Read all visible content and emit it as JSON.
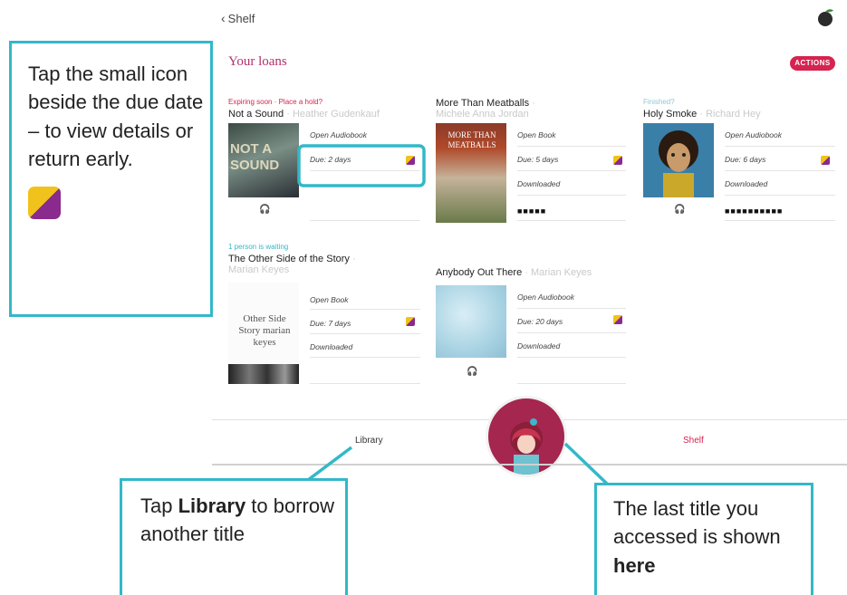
{
  "header": {
    "back_label": "Shelf",
    "section_title": "Your loans",
    "actions_label": "ACTIONS"
  },
  "loans": [
    {
      "tag": "Expiring soon · Place a hold?",
      "tag_color": "#d6234f",
      "title": "Not a Sound",
      "author": "Heather Gudenkauf",
      "cover_text": "NOT A SOUND",
      "action": "Open Audiobook",
      "due": "Due: 2 days",
      "status": "",
      "progress": ""
    },
    {
      "tag": "",
      "tag_color": "#d6234f",
      "title": "More Than Meatballs",
      "author": "Michele Anna Jordan",
      "cover_text": "MORE THAN MEATBALLS",
      "action": "Open Book",
      "due": "Due: 5 days",
      "status": "Downloaded",
      "progress": "■■■■■"
    },
    {
      "tag": "Finished?",
      "tag_color": "#8fc9d5",
      "title": "Holy Smoke",
      "author": "Richard Hey",
      "cover_text": "",
      "action": "Open Audiobook",
      "due": "Due: 6 days",
      "status": "Downloaded",
      "progress": "■■■■■■■■■■"
    },
    {
      "tag": "1 person is waiting",
      "tag_color": "#33b8c9",
      "title": "The Other Side of the Story",
      "author": "Marian Keyes",
      "cover_text": "Other Side Story marian keyes",
      "action": "Open Book",
      "due": "Due: 7 days",
      "status": "Downloaded",
      "progress": ""
    },
    {
      "tag": "",
      "tag_color": "#d6234f",
      "title": "Anybody Out There",
      "author": "Marian Keyes",
      "cover_text": "",
      "action": "Open Audiobook",
      "due": "Due: 20 days",
      "status": "Downloaded",
      "progress": ""
    }
  ],
  "tabbar": {
    "library_label": "Library",
    "shelf_label": "Shelf"
  },
  "callouts": {
    "due_icon": {
      "text": "Tap the small icon beside the due date – to view details or return early."
    },
    "library": {
      "pre": "Tap ",
      "bold": "Library",
      "post": " to borrow another title"
    },
    "last_title": {
      "pre": "The last title you accessed is shown ",
      "bold": "here"
    }
  },
  "colors": {
    "accent": "#d6234f",
    "callout_border": "#33b8c9",
    "section_title": "#b0306b"
  },
  "icons": {
    "back": "chevron-left-icon",
    "avatar": "leaf-avatar-icon",
    "detail": "details-square-icon",
    "audio": "headphones-icon"
  }
}
